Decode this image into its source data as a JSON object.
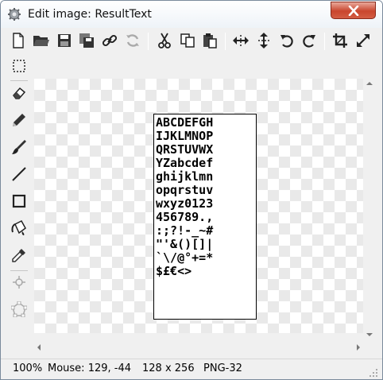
{
  "window": {
    "title": "Edit image: ResultText"
  },
  "toolbar": {
    "buttons": [
      {
        "icon": "new-file-icon"
      },
      {
        "icon": "open-folder-icon"
      },
      {
        "icon": "save-icon"
      },
      {
        "icon": "save-copy-icon"
      },
      {
        "icon": "link-icon"
      },
      {
        "icon": "refresh-icon"
      },
      {
        "icon": "cut-icon"
      },
      {
        "icon": "copy-icon"
      },
      {
        "icon": "paste-icon"
      },
      {
        "icon": "flip-horizontal-icon"
      },
      {
        "icon": "flip-vertical-icon"
      },
      {
        "icon": "rotate-left-icon"
      },
      {
        "icon": "rotate-right-icon"
      },
      {
        "icon": "crop-icon"
      },
      {
        "icon": "resize-icon"
      }
    ]
  },
  "tools": [
    {
      "icon": "selection-icon"
    },
    {
      "icon": "eraser-icon"
    },
    {
      "icon": "pencil-icon"
    },
    {
      "icon": "brush-icon"
    },
    {
      "icon": "line-icon"
    },
    {
      "icon": "rectangle-icon"
    },
    {
      "icon": "fill-bucket-icon"
    },
    {
      "icon": "eyedropper-icon"
    },
    {
      "icon": "crosshair-icon"
    },
    {
      "icon": "polygon-icon"
    }
  ],
  "image": {
    "glyph_rows": [
      "ABCDEFGH",
      "IJKLMNOP",
      "QRSTUVWX",
      "YZabcdef",
      "ghijklmn",
      "opqrstuv",
      "wxyz0123",
      "456789.,",
      ":;?!-_~#",
      "\"'&()[]|",
      "`\\/@°+=*",
      "$£€<>"
    ]
  },
  "status": {
    "zoom": "100%",
    "mouse": "Mouse: 129, -44",
    "size": "128 x 256",
    "format": "PNG-32"
  },
  "colors": {
    "close_button": "#c9462e",
    "window_border": "#7a8a9c",
    "checker": "#e9e9e9"
  }
}
